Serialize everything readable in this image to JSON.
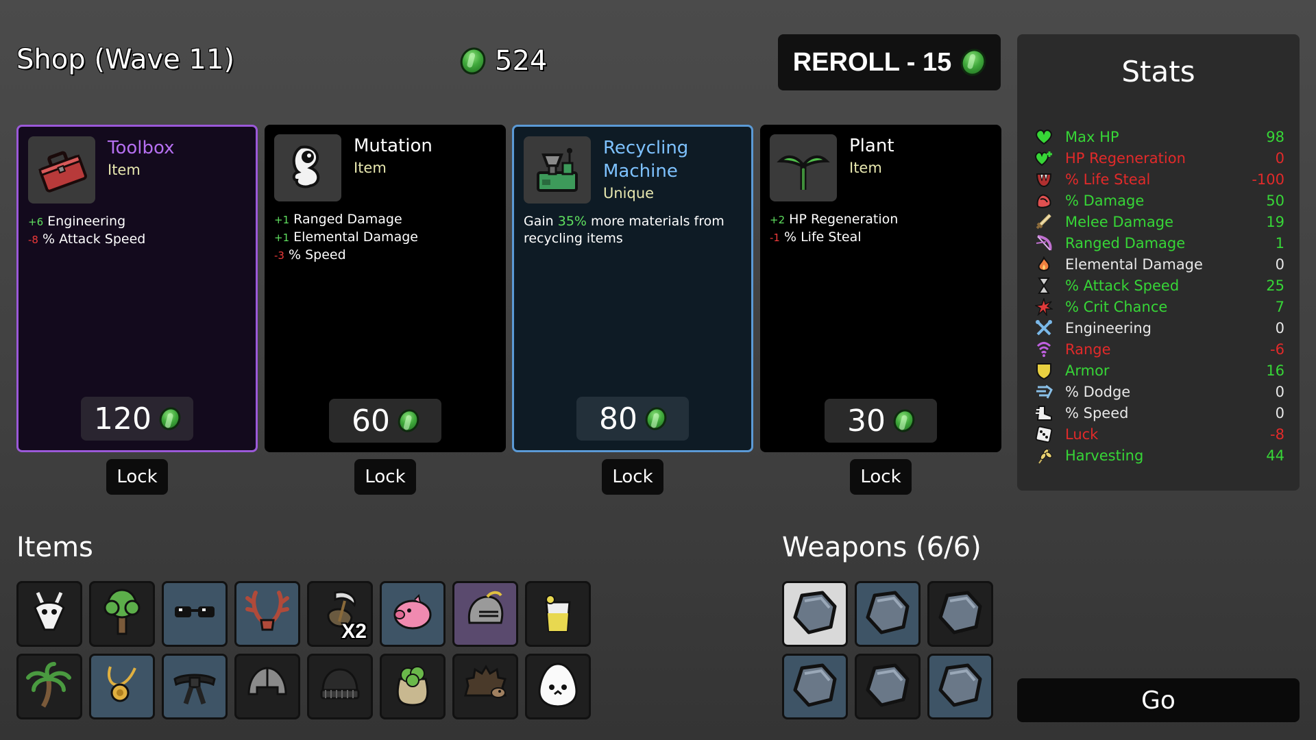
{
  "header": {
    "title": "Shop (Wave 11)",
    "materials": "524",
    "reroll_label": "REROLL - 15"
  },
  "shop": [
    {
      "name": "Toolbox",
      "type": "Item",
      "name_color": "#b56ff0",
      "price": "120",
      "lock_label": "Lock",
      "effects": [
        {
          "sign": "+6",
          "text": " Engineering",
          "kind": "pos"
        },
        {
          "sign": "-8",
          "text": " % Attack Speed",
          "kind": "neg"
        }
      ]
    },
    {
      "name": "Mutation",
      "type": "Item",
      "name_color": "#ffffff",
      "price": "60",
      "lock_label": "Lock",
      "effects": [
        {
          "sign": "+1",
          "text": " Ranged Damage",
          "kind": "pos"
        },
        {
          "sign": "+1",
          "text": " Elemental Damage",
          "kind": "pos"
        },
        {
          "sign": "-3",
          "text": " % Speed",
          "kind": "neg"
        }
      ]
    },
    {
      "name": "Recycling Machine",
      "type": "Unique",
      "name_color": "#7ec2ff",
      "price": "80",
      "lock_label": "Lock",
      "desc_pre": "Gain ",
      "desc_hl": "35%",
      "desc_post": " more materials from recycling items"
    },
    {
      "name": "Plant",
      "type": "Item",
      "name_color": "#ffffff",
      "price": "30",
      "lock_label": "Lock",
      "effects": [
        {
          "sign": "+2",
          "text": " HP Regeneration",
          "kind": "pos"
        },
        {
          "sign": "-1",
          "text": " % Life Steal",
          "kind": "neg"
        }
      ]
    }
  ],
  "stats": {
    "title": "Stats",
    "rows": [
      {
        "label": "Max HP",
        "value": "98",
        "color": "#37d637",
        "icon": "heart-icon"
      },
      {
        "label": "HP Regeneration",
        "value": "0",
        "color": "#e22a2a",
        "icon": "heart-plus-icon"
      },
      {
        "label": "% Life Steal",
        "value": "-100",
        "color": "#e22a2a",
        "icon": "fangs-icon"
      },
      {
        "label": "% Damage",
        "value": "50",
        "color": "#37d637",
        "icon": "muscle-icon"
      },
      {
        "label": "Melee Damage",
        "value": "19",
        "color": "#37d637",
        "icon": "sword-icon"
      },
      {
        "label": "Ranged Damage",
        "value": "1",
        "color": "#37d637",
        "icon": "bow-icon"
      },
      {
        "label": "Elemental Damage",
        "value": "0",
        "color": "#e8e8e8",
        "icon": "flame-icon"
      },
      {
        "label": "% Attack Speed",
        "value": "25",
        "color": "#37d637",
        "icon": "hourglass-icon"
      },
      {
        "label": "% Crit Chance",
        "value": "7",
        "color": "#37d637",
        "icon": "crit-burst-icon"
      },
      {
        "label": "Engineering",
        "value": "0",
        "color": "#e8e8e8",
        "icon": "wrench-cross-icon"
      },
      {
        "label": "Range",
        "value": "-6",
        "color": "#e22a2a",
        "icon": "range-waves-icon"
      },
      {
        "label": "Armor",
        "value": "16",
        "color": "#37d637",
        "icon": "shield-icon"
      },
      {
        "label": "% Dodge",
        "value": "0",
        "color": "#e8e8e8",
        "icon": "dodge-icon"
      },
      {
        "label": "% Speed",
        "value": "0",
        "color": "#e8e8e8",
        "icon": "boot-icon"
      },
      {
        "label": "Luck",
        "value": "-8",
        "color": "#e22a2a",
        "icon": "dice-icon"
      },
      {
        "label": "Harvesting",
        "value": "44",
        "color": "#37d637",
        "icon": "wheat-icon"
      }
    ]
  },
  "items": {
    "title": "Items",
    "slots": [
      {
        "icon": "goat-skull-icon",
        "tier": "t0"
      },
      {
        "icon": "tree-icon",
        "tier": "t0"
      },
      {
        "icon": "sunglasses-icon",
        "tier": "t1"
      },
      {
        "icon": "antlers-icon",
        "tier": "t1"
      },
      {
        "icon": "scythe-bag-icon",
        "tier": "t0",
        "qty": "X2"
      },
      {
        "icon": "piggy-bank-icon",
        "tier": "t1"
      },
      {
        "icon": "knight-helmet-icon",
        "tier": "t2"
      },
      {
        "icon": "lemonade-icon",
        "tier": "t0"
      },
      {
        "icon": "palm-tree-icon",
        "tier": "t0"
      },
      {
        "icon": "pendant-icon",
        "tier": "t1"
      },
      {
        "icon": "black-belt-icon",
        "tier": "t1"
      },
      {
        "icon": "helmet-icon",
        "tier": "t0"
      },
      {
        "icon": "beanie-icon",
        "tier": "t0"
      },
      {
        "icon": "fertilizer-sack-icon",
        "tier": "t0"
      },
      {
        "icon": "hedgehog-icon",
        "tier": "t0"
      },
      {
        "icon": "egg-icon",
        "tier": "t0"
      }
    ]
  },
  "weapons": {
    "title": "Weapons (6/6)",
    "slots": [
      {
        "icon": "rock-icon",
        "tier": "sel"
      },
      {
        "icon": "rock-icon",
        "tier": "t1"
      },
      {
        "icon": "rock-icon",
        "tier": "t0"
      },
      {
        "icon": "rock-icon",
        "tier": "t1"
      },
      {
        "icon": "rock-icon",
        "tier": "t0"
      },
      {
        "icon": "rock-icon",
        "tier": "t1"
      }
    ]
  },
  "go_label": "Go"
}
